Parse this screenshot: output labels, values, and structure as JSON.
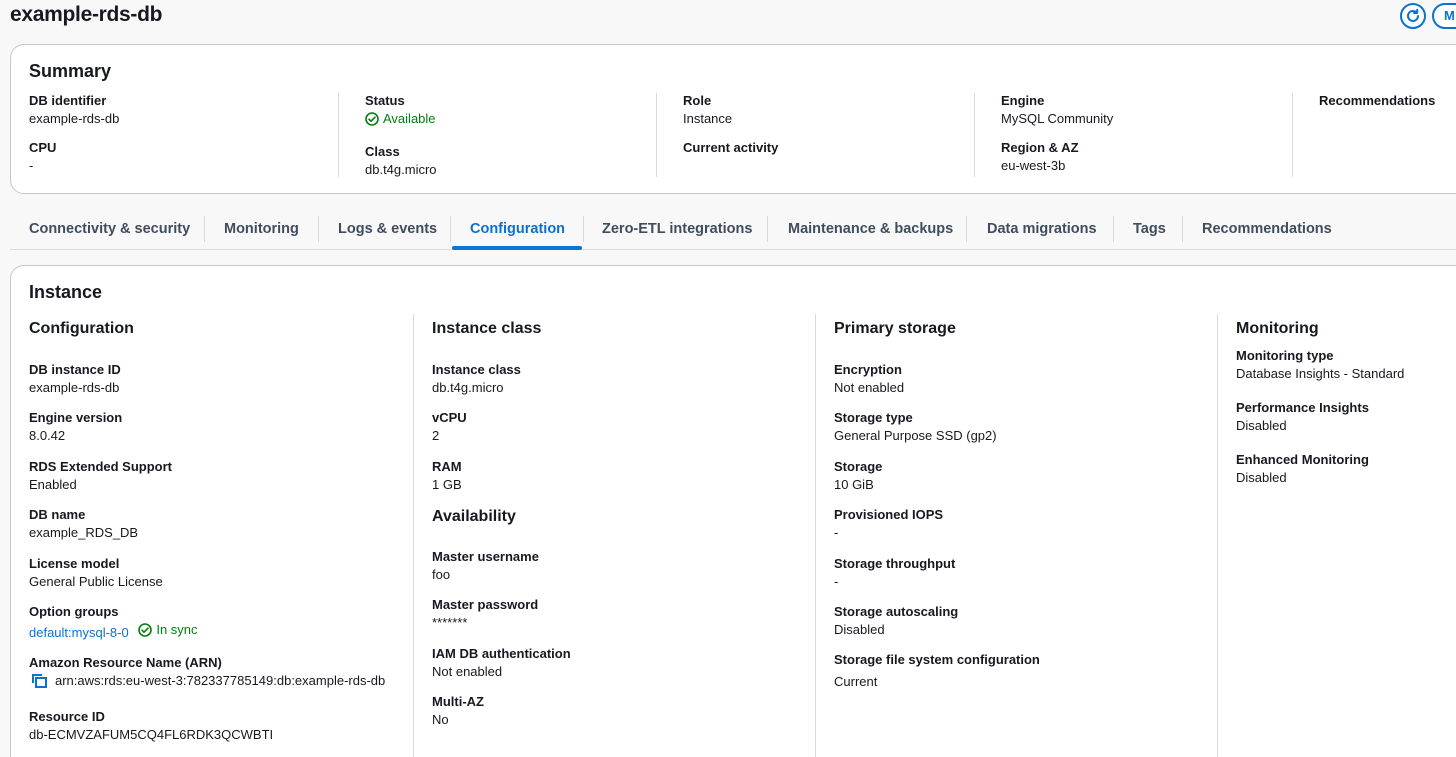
{
  "page": {
    "title": "example-rds-db"
  },
  "top_actions": {
    "modify_label": "M"
  },
  "summary": {
    "title": "Summary",
    "db_identifier": {
      "label": "DB identifier",
      "value": "example-rds-db"
    },
    "cpu": {
      "label": "CPU",
      "value": "-"
    },
    "status": {
      "label": "Status",
      "value": "Available"
    },
    "class": {
      "label": "Class",
      "value": "db.t4g.micro"
    },
    "role": {
      "label": "Role",
      "value": "Instance"
    },
    "current_activity": {
      "label": "Current activity",
      "value": ""
    },
    "engine": {
      "label": "Engine",
      "value": "MySQL Community"
    },
    "region_az": {
      "label": "Region & AZ",
      "value": "eu-west-3b"
    },
    "recommendations": {
      "label": "Recommendations",
      "value": ""
    }
  },
  "tabs": [
    {
      "label": "Connectivity & security"
    },
    {
      "label": "Monitoring"
    },
    {
      "label": "Logs & events"
    },
    {
      "label": "Configuration",
      "active": true
    },
    {
      "label": "Zero-ETL integrations"
    },
    {
      "label": "Maintenance & backups"
    },
    {
      "label": "Data migrations"
    },
    {
      "label": "Tags"
    },
    {
      "label": "Recommendations"
    }
  ],
  "instance": {
    "title": "Instance",
    "configuration": {
      "heading": "Configuration",
      "db_instance_id": {
        "label": "DB instance ID",
        "value": "example-rds-db"
      },
      "engine_version": {
        "label": "Engine version",
        "value": "8.0.42"
      },
      "extended_support": {
        "label": "RDS Extended Support",
        "value": "Enabled"
      },
      "db_name": {
        "label": "DB name",
        "value": "example_RDS_DB"
      },
      "license_model": {
        "label": "License model",
        "value": "General Public License"
      },
      "option_groups": {
        "label": "Option groups",
        "value": "default:mysql-8-0",
        "status": "In sync"
      },
      "arn": {
        "label": "Amazon Resource Name (ARN)",
        "value": "arn:aws:rds:eu-west-3:782337785149:db:example-rds-db"
      },
      "resource_id": {
        "label": "Resource ID",
        "value": "db-ECMVZAFUM5CQ4FL6RDK3QCWBTI"
      }
    },
    "instance_class": {
      "heading": "Instance class",
      "instance_class": {
        "label": "Instance class",
        "value": "db.t4g.micro"
      },
      "vcpu": {
        "label": "vCPU",
        "value": "2"
      },
      "ram": {
        "label": "RAM",
        "value": "1 GB"
      }
    },
    "availability": {
      "heading": "Availability",
      "master_username": {
        "label": "Master username",
        "value": "foo"
      },
      "master_password": {
        "label": "Master password",
        "value": "*******"
      },
      "iam_auth": {
        "label": "IAM DB authentication",
        "value": "Not enabled"
      },
      "multi_az": {
        "label": "Multi-AZ",
        "value": "No"
      }
    },
    "primary_storage": {
      "heading": "Primary storage",
      "encryption": {
        "label": "Encryption",
        "value": "Not enabled"
      },
      "storage_type": {
        "label": "Storage type",
        "value": "General Purpose SSD (gp2)"
      },
      "storage": {
        "label": "Storage",
        "value": "10 GiB"
      },
      "provisioned_iops": {
        "label": "Provisioned IOPS",
        "value": "-"
      },
      "storage_throughput": {
        "label": "Storage throughput",
        "value": "-"
      },
      "storage_autoscaling": {
        "label": "Storage autoscaling",
        "value": "Disabled"
      },
      "fs_config": {
        "label": "Storage file system configuration",
        "value": "Current"
      }
    },
    "monitoring": {
      "heading": "Monitoring",
      "monitoring_type": {
        "label": "Monitoring type",
        "value": "Database Insights - Standard"
      },
      "performance_insights": {
        "label": "Performance Insights",
        "value": "Disabled"
      },
      "enhanced_monitoring": {
        "label": "Enhanced Monitoring",
        "value": "Disabled"
      }
    }
  },
  "colors": {
    "accent": "#0972d3",
    "success": "#037f0c",
    "border": "#c6c6cd",
    "text": "#16191f"
  }
}
